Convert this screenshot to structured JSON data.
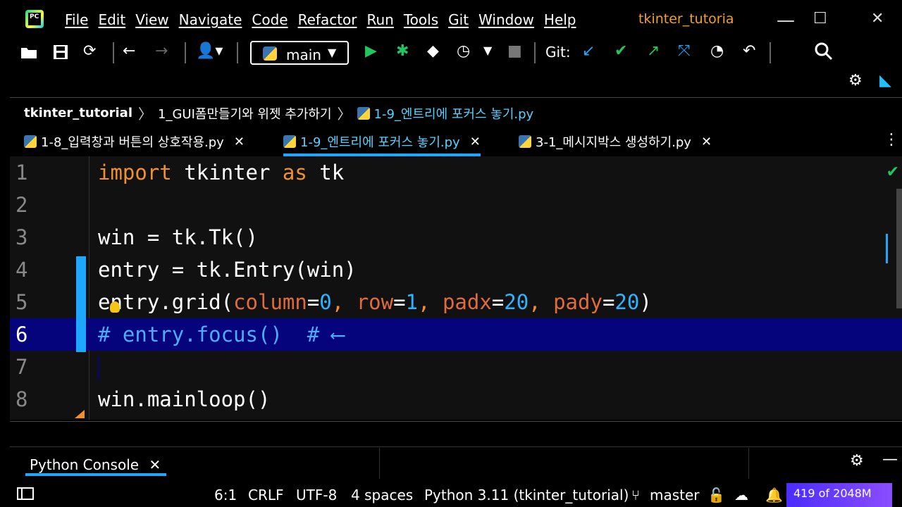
{
  "menubar": {
    "items": [
      "File",
      "Edit",
      "View",
      "Navigate",
      "Code",
      "Refactor",
      "Run",
      "Tools",
      "Git",
      "Window",
      "Help"
    ],
    "project_title": "tkinter_tutoria"
  },
  "toolbar": {
    "branch": "main",
    "git_label": "Git:"
  },
  "breadcrumb": {
    "project": "tkinter_tutorial",
    "folder": "1_GUI폼만들기와 위젯 추가하기",
    "file": "1-9_엔트리에 포커스 놓기.py"
  },
  "tabs": [
    {
      "label": "1-8_입력창과 버튼의 상호작용.py"
    },
    {
      "label": "1-9_엔트리에 포커스 놓기.py"
    },
    {
      "label": "3-1_메시지박스 생성하기.py"
    }
  ],
  "editor": {
    "lines": [
      {
        "num": "1"
      },
      {
        "num": "2"
      },
      {
        "num": "3"
      },
      {
        "num": "4"
      },
      {
        "num": "5"
      },
      {
        "num": "6"
      },
      {
        "num": "7"
      },
      {
        "num": "8"
      }
    ],
    "code": {
      "l1_import": "import",
      "l1_mod": " tkinter ",
      "l1_as": "as",
      "l1_alias": " tk",
      "l3": "win = tk.Tk()",
      "l4": "entry = tk.Entry(win)",
      "l5_a": "entry.grid(",
      "l5_column": "column",
      "l5_eq1": "=",
      "l5_v1": "0",
      "l5_c1": ", ",
      "l5_row": "row",
      "l5_eq2": "=",
      "l5_v2": "1",
      "l5_c2": ", ",
      "l5_padx": "padx",
      "l5_eq3": "=",
      "l5_v3": "20",
      "l5_c3": ", ",
      "l5_pady": "pady",
      "l5_eq4": "=",
      "l5_v4": "20",
      "l5_end": ")",
      "l6": "# entry.focus()  # ⟵",
      "l8": "win.mainloop()"
    }
  },
  "console": {
    "tab_label": "Python Console"
  },
  "statusbar": {
    "position": "6:1",
    "line_sep": "CRLF",
    "encoding": "UTF-8",
    "indent": "4 spaces",
    "interpreter": "Python 3.11 (tkinter_tutorial)",
    "branch": "master",
    "memory": "419 of 2048M"
  },
  "colors": {
    "accent": "#1ea7ff",
    "current_line": "#05047d",
    "keyword": "#f09030"
  }
}
